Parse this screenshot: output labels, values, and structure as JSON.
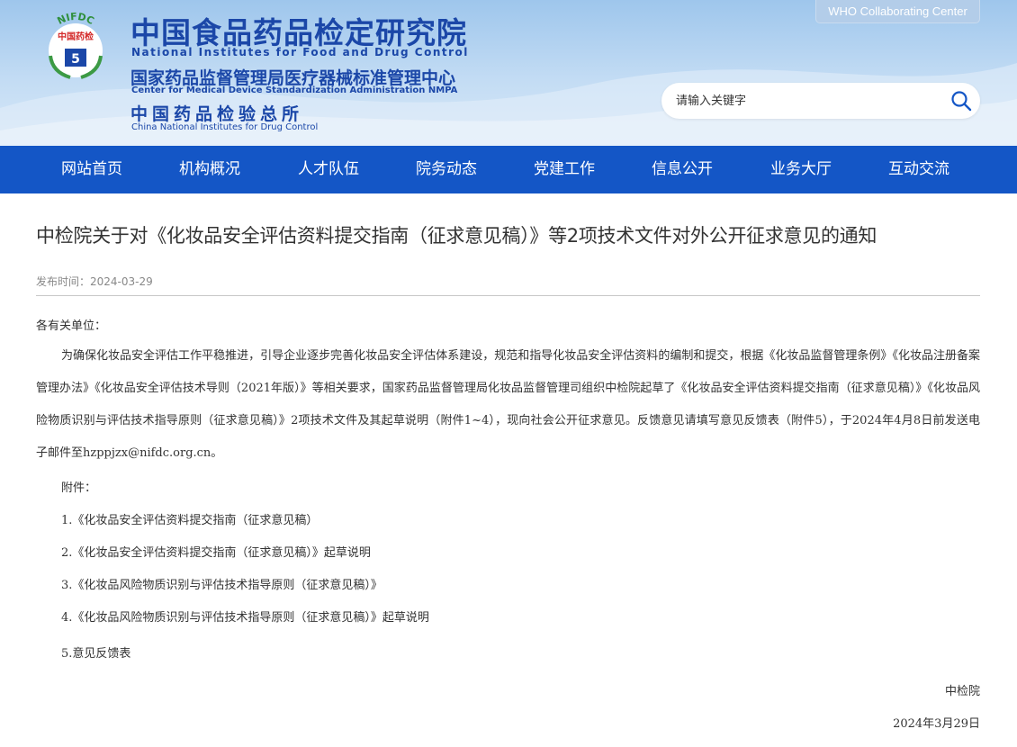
{
  "header": {
    "logo_text_top": "NIFDC",
    "logo_text_mid": "中国药检",
    "org_cn_main": "中国食品药品检定研究院",
    "org_en_main": "National Institutes for Food and Drug Control",
    "org_cn_sub": "国家药品监督管理局医疗器械标准管理中心",
    "org_en_sub": "Center for Medical Device Standardization Administration NMPA",
    "org_cn_sub2": "中国药品检验总所",
    "org_en_sub2": "China National Institutes for Drug Control",
    "who_badge": "WHO Collaborating Center",
    "search_placeholder": "请输入关键字",
    "search_icon": "search-icon"
  },
  "nav": {
    "items": [
      "网站首页",
      "机构概况",
      "人才队伍",
      "院务动态",
      "党建工作",
      "信息公开",
      "业务大厅",
      "互动交流"
    ]
  },
  "article": {
    "title": "中检院关于对《化妆品安全评估资料提交指南（征求意见稿）》等2项技术文件对外公开征求意见的通知",
    "published_label": "发布时间：",
    "published_date": "2024-03-29",
    "salutation": "各有关单位：",
    "paragraph": "为确保化妆品安全评估工作平稳推进，引导企业逐步完善化妆品安全评估体系建设，规范和指导化妆品安全评估资料的编制和提交，根据《化妆品监督管理条例》《化妆品注册备案管理办法》《化妆品安全评估技术导则（2021年版）》等相关要求，国家药品监督管理局化妆品监督管理司组织中检院起草了《化妆品安全评估资料提交指南（征求意见稿）》《化妆品风险物质识别与评估技术指导原则（征求意见稿）》2项技术文件及其起草说明（附件1~4），现向社会公开征求意见。反馈意见请填写意见反馈表（附件5），于2024年4月8日前发送电子邮件至hzppjzx@nifdc.org.cn。",
    "attachments_label": "附件：",
    "attachments": [
      "1.《化妆品安全评估资料提交指南（征求意见稿）",
      "2.《化妆品安全评估资料提交指南（征求意见稿）》起草说明",
      "3.《化妆品风险物质识别与评估技术指导原则（征求意见稿）》",
      "4.《化妆品风险物质识别与评估技术指导原则（征求意见稿）》起草说明",
      "5.意见反馈表"
    ],
    "signature": "中检院",
    "signature_date": "2024年3月29日"
  },
  "colors": {
    "nav_bg": "#1456c6",
    "brand_blue": "#1b47a8",
    "header_bg": "#b8d5f1"
  }
}
